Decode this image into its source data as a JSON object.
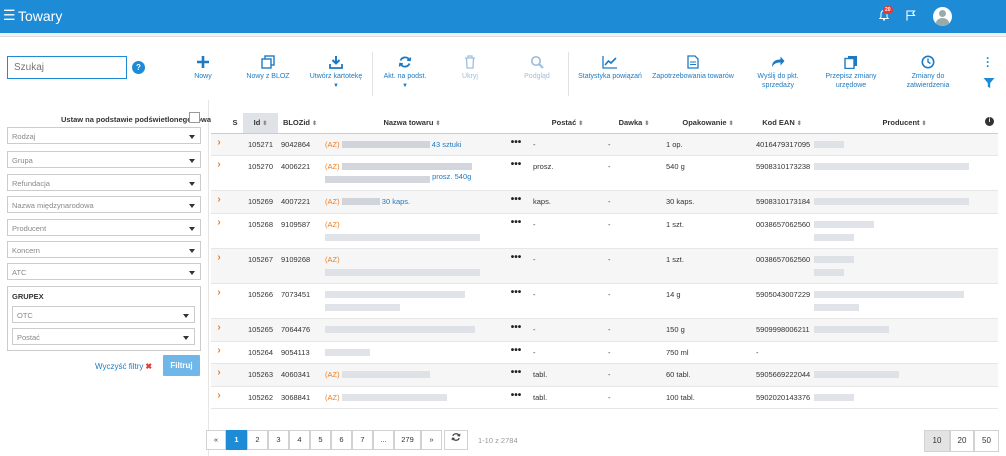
{
  "header": {
    "title": "Towary",
    "notif_count": "20"
  },
  "search": {
    "placeholder": "Szukaj",
    "help_icon": "question-icon"
  },
  "toolbar": {
    "new": "Nowy",
    "new_bloz": "Nowy z BLOZ",
    "create_card": "Utwórz kartotekę",
    "update_base": "Akt. na podst.",
    "hide": "Ukryj",
    "preview": "Podgląd",
    "stats": "Statystyka powiązań",
    "demand": "Zapotrzebowania towarów",
    "send_line1": "Wyślij do pkt.",
    "send_line2": "sprzedaży",
    "rewrite_line1": "Przepisz zmiany",
    "rewrite_line2": "urzędowe",
    "approve": "Zmiany do zatwierdzenia"
  },
  "filters": {
    "set_by_highlight": "Ustaw na podstawie podświetlonego towaru",
    "rodzaj": "Rodzaj",
    "grupa": "Grupa",
    "refundacja": "Refundacja",
    "nazwa_miedzynarodowa": "Nazwa międzynarodowa",
    "producent": "Producent",
    "koncern": "Koncern",
    "atc": "ATC",
    "grupex_title": "GRUPEX",
    "otc": "OTC",
    "postac": "Postać",
    "clear": "Wyczyść filtry",
    "filter_btn": "Filtruj"
  },
  "table": {
    "headers": {
      "s": "S",
      "id": "Id",
      "bloz": "BLOZid",
      "name": "Nazwa towaru",
      "form": "Postać",
      "dose": "Dawka",
      "package": "Opakowanie",
      "ean": "Kod EAN",
      "producer": "Producent"
    },
    "rows": [
      {
        "id": "105271",
        "bloz": "9042864",
        "az": "(AZ)",
        "name_suffix": "43 sztuki",
        "form": "-",
        "dose": "-",
        "package": "1 op.",
        "ean": "4016479317095"
      },
      {
        "id": "105270",
        "bloz": "4006221",
        "az": "(AZ)",
        "name_suffix": "prosz. 540g",
        "form": "prosz.",
        "dose": "-",
        "package": "540 g",
        "ean": "5908310173238"
      },
      {
        "id": "105269",
        "bloz": "4007221",
        "az": "(AZ)",
        "name_suffix": "30 kaps.",
        "form": "kaps.",
        "dose": "-",
        "package": "30 kaps.",
        "ean": "5908310173184"
      },
      {
        "id": "105268",
        "bloz": "9109587",
        "az": "(AZ)",
        "name_suffix": "",
        "form": "-",
        "dose": "-",
        "package": "1 szt.",
        "ean": "0038657062560"
      },
      {
        "id": "105267",
        "bloz": "9109268",
        "az": "(AZ)",
        "name_suffix": "",
        "form": "-",
        "dose": "-",
        "package": "1 szt.",
        "ean": "0038657062560"
      },
      {
        "id": "105266",
        "bloz": "7073451",
        "az": "",
        "name_suffix": "",
        "form": "-",
        "dose": "-",
        "package": "14 g",
        "ean": "5905043007229"
      },
      {
        "id": "105265",
        "bloz": "7064476",
        "az": "",
        "name_suffix": "",
        "form": "-",
        "dose": "-",
        "package": "150 g",
        "ean": "5909998006211"
      },
      {
        "id": "105264",
        "bloz": "9054113",
        "az": "",
        "name_suffix": "",
        "form": "-",
        "dose": "-",
        "package": "750 ml",
        "ean": "-"
      },
      {
        "id": "105263",
        "bloz": "4060341",
        "az": "(AZ)",
        "name_suffix": "",
        "form": "tabl.",
        "dose": "-",
        "package": "60 tabl.",
        "ean": "5905669222044"
      },
      {
        "id": "105262",
        "bloz": "3068841",
        "az": "(AZ)",
        "name_suffix": "",
        "form": "tabl.",
        "dose": "-",
        "package": "100 tabl.",
        "ean": "5902020143376"
      }
    ]
  },
  "pagination": {
    "prev": "«",
    "next": "»",
    "pages": [
      "1",
      "2",
      "3",
      "4",
      "5",
      "6",
      "7",
      "...",
      "279"
    ],
    "range": "1-10 z 2784",
    "sizes": [
      "10",
      "20",
      "50"
    ]
  },
  "colors": {
    "brand": "#1e8bd6",
    "accent": "#f07c1f"
  }
}
